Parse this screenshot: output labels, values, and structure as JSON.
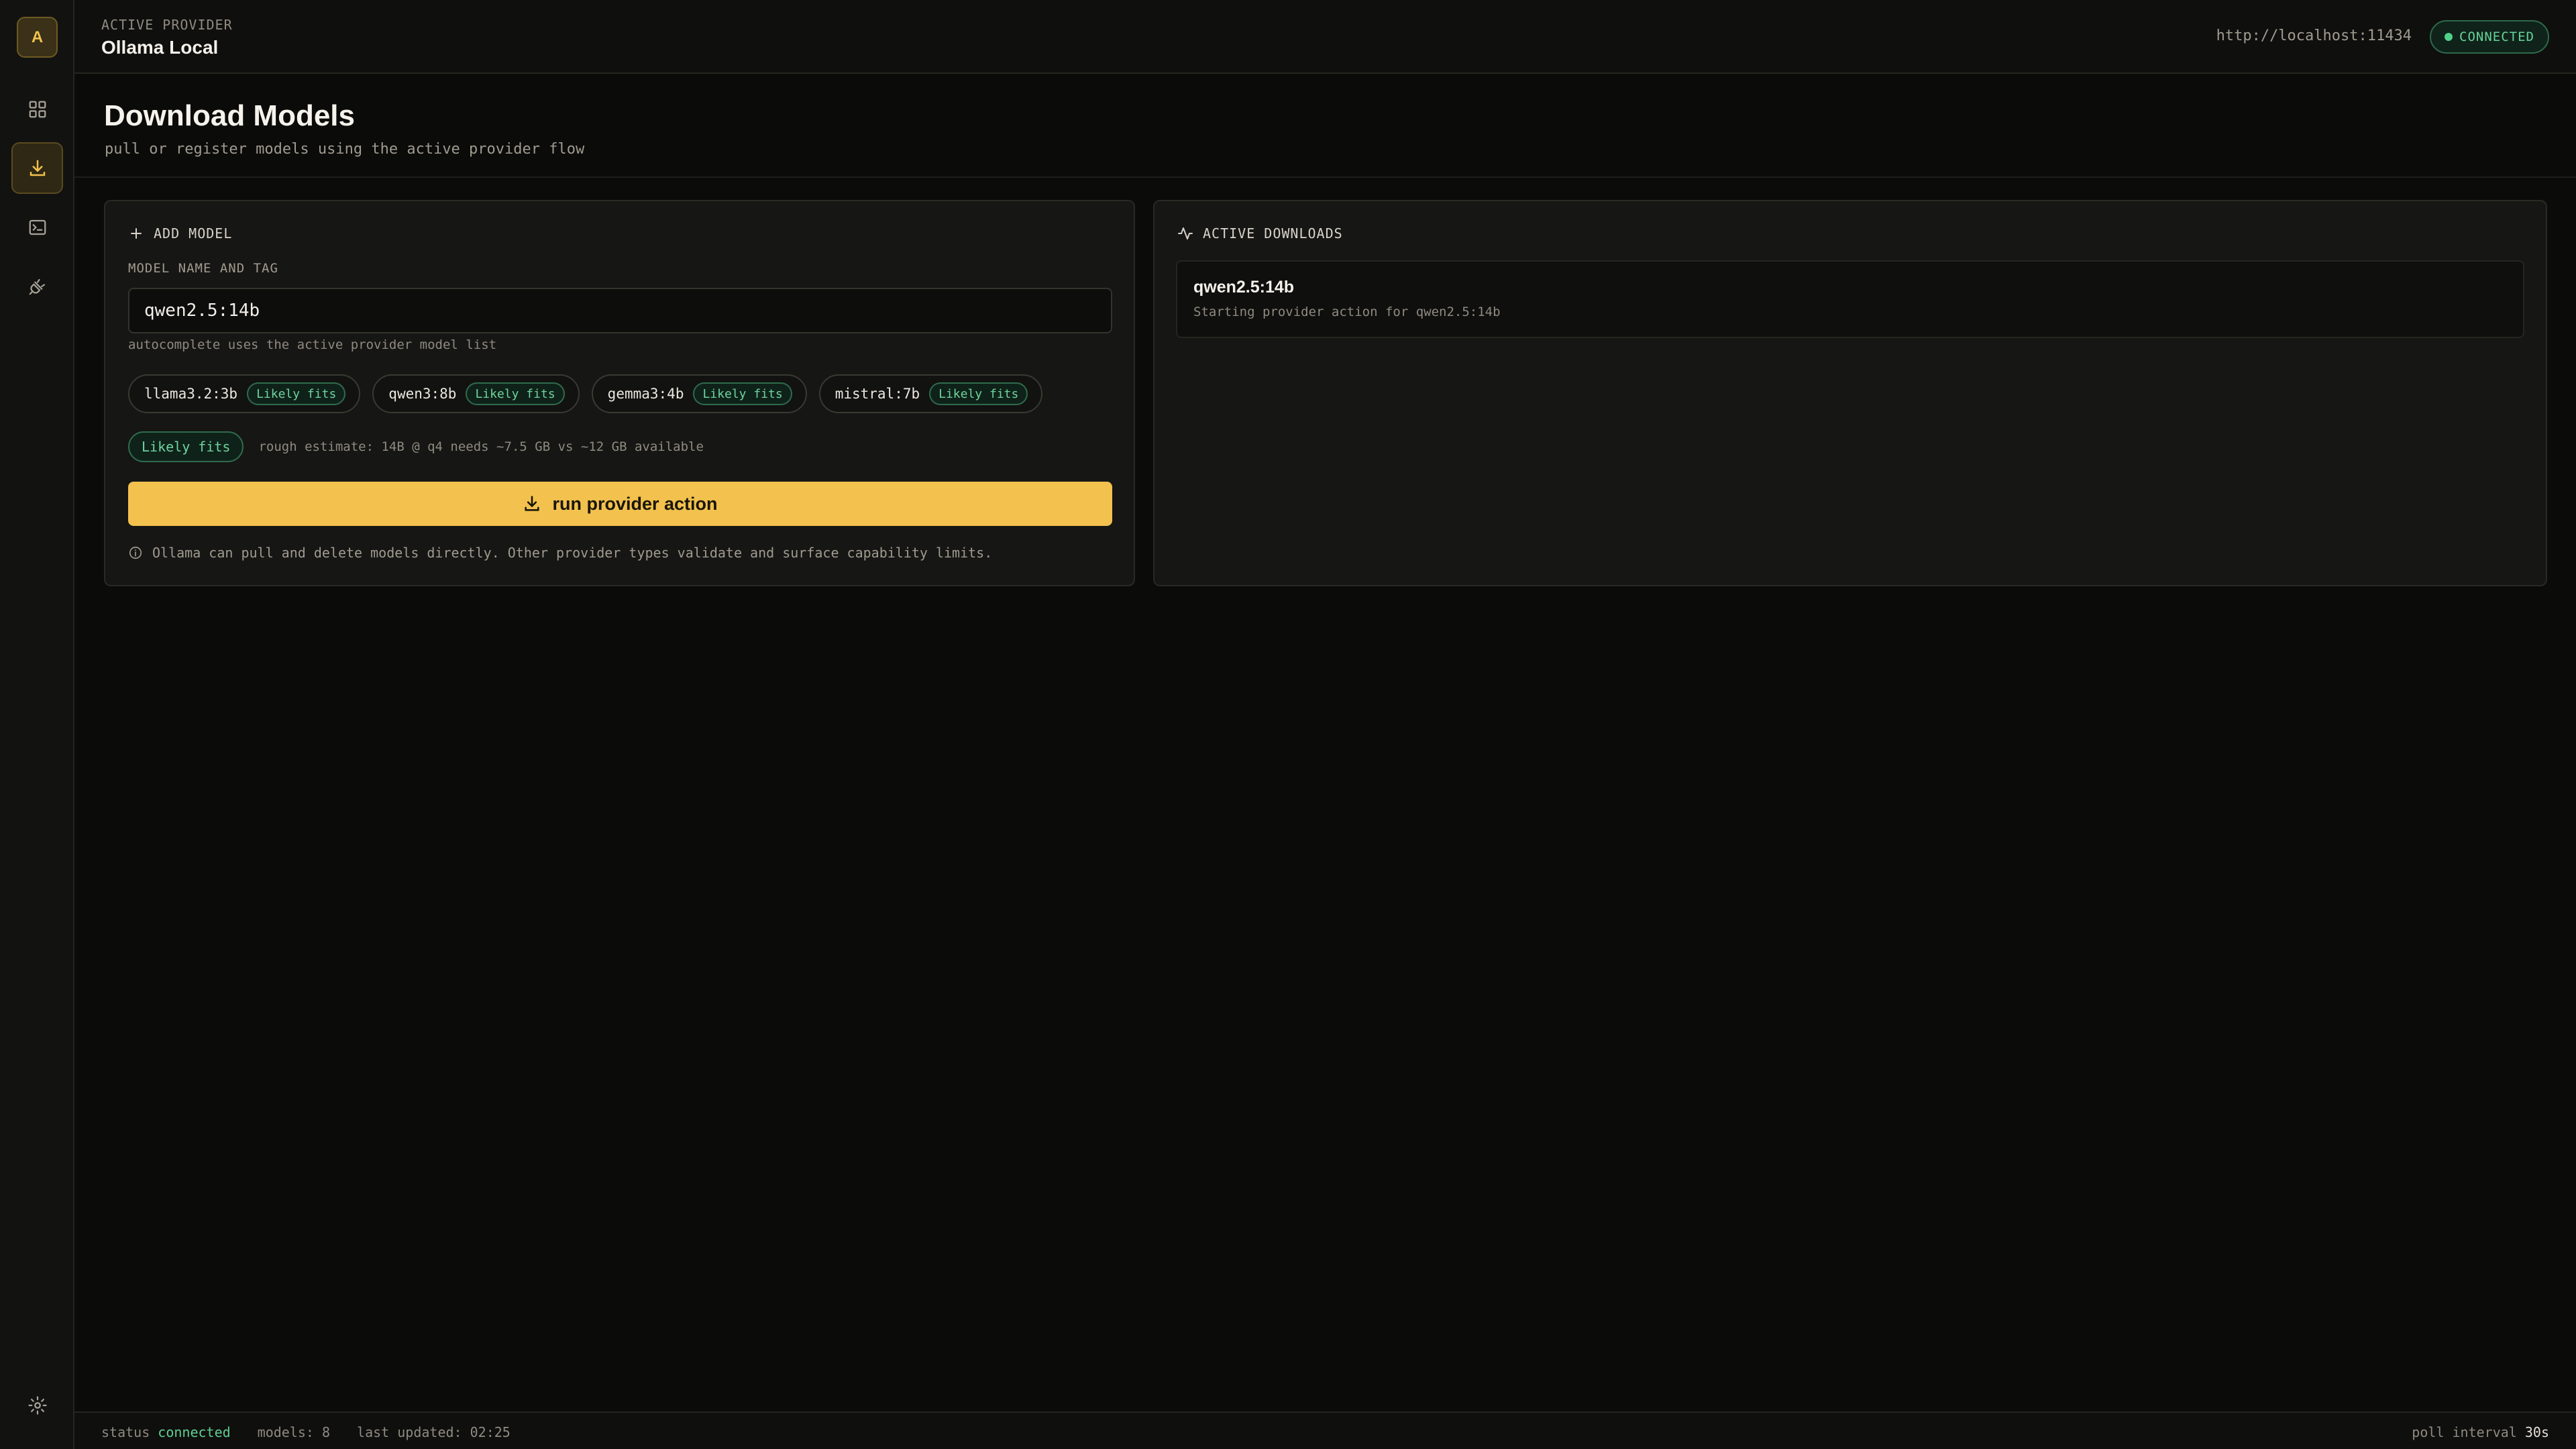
{
  "sidebar": {
    "avatar_letter": "A",
    "items": [
      {
        "name": "dashboard",
        "icon": "grid-icon"
      },
      {
        "name": "downloads",
        "icon": "download-icon",
        "active": true
      },
      {
        "name": "terminal",
        "icon": "terminal-icon"
      },
      {
        "name": "providers",
        "icon": "plug-icon"
      }
    ],
    "footer_icon": "gear-icon"
  },
  "header": {
    "label": "ACTIVE PROVIDER",
    "provider_name": "Ollama Local",
    "endpoint": "http://localhost:11434",
    "connection_status": "CONNECTED"
  },
  "page": {
    "title": "Download Models",
    "subtitle": "pull or register models using the active provider flow"
  },
  "add_model": {
    "title": "ADD MODEL",
    "field_label": "MODEL NAME AND TAG",
    "input_value": "qwen2.5:14b",
    "hint": "autocomplete uses the active provider model list",
    "suggestions": [
      {
        "name": "llama3.2:3b",
        "fit": "Likely fits"
      },
      {
        "name": "qwen3:8b",
        "fit": "Likely fits"
      },
      {
        "name": "gemma3:4b",
        "fit": "Likely fits"
      },
      {
        "name": "mistral:7b",
        "fit": "Likely fits"
      }
    ],
    "estimate_badge": "Likely fits",
    "estimate_text": "rough estimate: 14B @ q4 needs ~7.5 GB vs ~12 GB available",
    "run_button": "run provider action",
    "info_text": "Ollama can pull and delete models directly. Other provider types validate and surface capability limits."
  },
  "downloads": {
    "title": "ACTIVE DOWNLOADS",
    "items": [
      {
        "name": "qwen2.5:14b",
        "status": "Starting provider action for qwen2.5:14b"
      }
    ]
  },
  "statusbar": {
    "status_label": "status",
    "status_value": "connected",
    "models": "models: 8",
    "last_updated": "last updated: 02:25",
    "poll_label": "poll interval",
    "poll_value": "30s"
  },
  "colors": {
    "accent": "#f2c14e",
    "success": "#4fd18b",
    "background": "#0b0b0a"
  }
}
